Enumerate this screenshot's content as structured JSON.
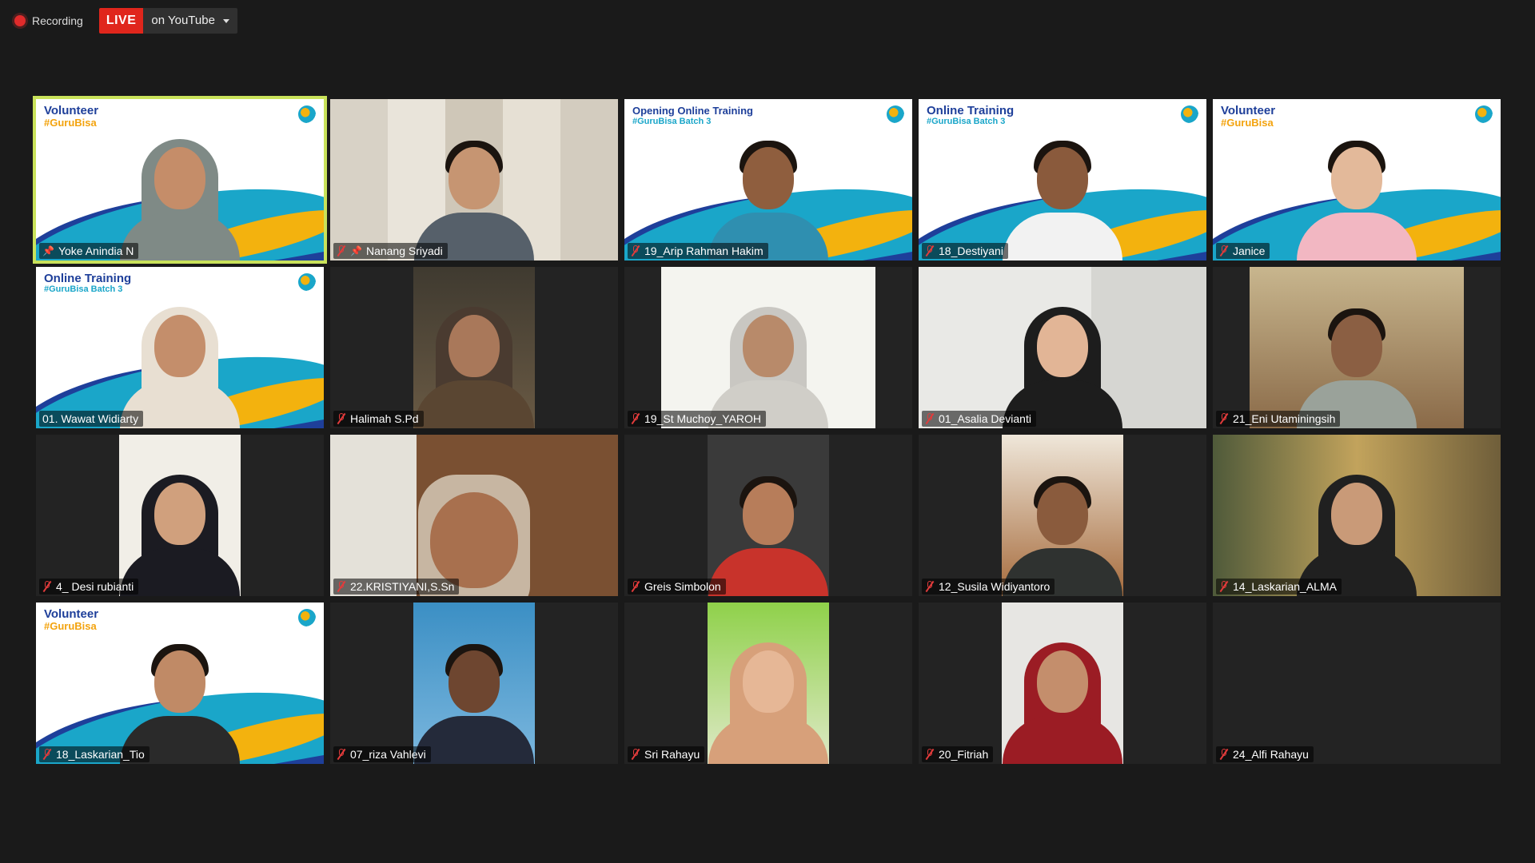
{
  "recording": {
    "label": "Recording"
  },
  "live": {
    "badge": "LIVE",
    "destination": "on YouTube"
  },
  "participants": [
    {
      "name": "Yoke Anindia N",
      "muted": false,
      "pinned": true,
      "active": true,
      "bg": {
        "title": "Volunteer",
        "sub": "#GuruBisa"
      }
    },
    {
      "name": "Nanang Sriyadi",
      "muted": true,
      "pinned": true
    },
    {
      "name": "19_Arip Rahman Hakim",
      "muted": true,
      "bg": {
        "title": "Opening Online Training",
        "sub": "#GuruBisa Batch 3"
      }
    },
    {
      "name": "18_Destiyani",
      "muted": true,
      "bg": {
        "title": "Online Training",
        "sub": "#GuruBisa Batch 3"
      }
    },
    {
      "name": "Janice",
      "muted": true,
      "bg": {
        "title": "Volunteer",
        "sub": "#GuruBisa"
      }
    },
    {
      "name": "01. Wawat Widiarty",
      "muted": false,
      "bg": {
        "title": "Online Training",
        "sub": "#GuruBisa Batch 3"
      }
    },
    {
      "name": "Halimah S.Pd",
      "muted": true
    },
    {
      "name": "19_St Muchoy_YAROH",
      "muted": true
    },
    {
      "name": "01_Asalia Devianti",
      "muted": true
    },
    {
      "name": "21_Eni Utaminingsih",
      "muted": true
    },
    {
      "name": "4_ Desi rubianti",
      "muted": true
    },
    {
      "name": "22.KRISTIYANI,S.Sn",
      "muted": true
    },
    {
      "name": "Greis Simbolon",
      "muted": true
    },
    {
      "name": "12_Susila Widiyantoro",
      "muted": true
    },
    {
      "name": "14_Laskarian_ALMA",
      "muted": true
    },
    {
      "name": "18_Laskarian_Tio",
      "muted": true,
      "bg": {
        "title": "Volunteer",
        "sub": "#GuruBisa"
      }
    },
    {
      "name": "07_riza Vahlevi",
      "muted": true
    },
    {
      "name": "Sri Rahayu",
      "muted": true
    },
    {
      "name": "20_Fitriah",
      "muted": true
    },
    {
      "name": "24_Alfi Rahayu",
      "muted": true
    }
  ]
}
